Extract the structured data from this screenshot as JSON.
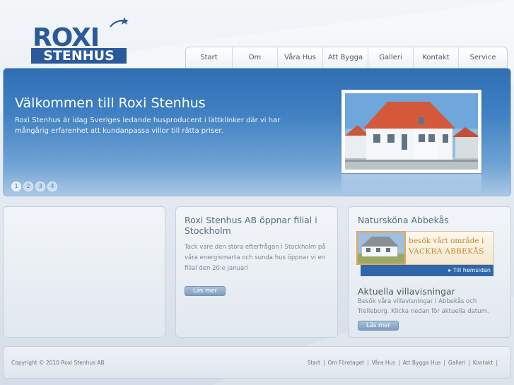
{
  "logo": {
    "line1": "ROXI",
    "line2": "STENHUS"
  },
  "nav": {
    "items": [
      {
        "label": "Start"
      },
      {
        "label": "Om"
      },
      {
        "label": "Våra Hus"
      },
      {
        "label": "Att Bygga"
      },
      {
        "label": "Galleri"
      },
      {
        "label": "Kontakt"
      },
      {
        "label": "Service"
      }
    ]
  },
  "hero": {
    "title": "Välkommen till Roxi Stenhus",
    "text": "Roxi Stenhus är idag Sveriges ledande husproducent i lättklinker där vi har mångårig erfarenhet att kundanpassa villor till rätta priser.",
    "dots": [
      "1",
      "2",
      "3",
      "4"
    ],
    "active_dot": 1
  },
  "news": {
    "title": "Roxi Stenhus AB öppnar filial i Stockholm",
    "body": "Tack vare den stora efterfrågan i Stockholm på våra energismarta och sunda hus öppnar vi en filial den 20:e januari",
    "button": "Läs mer"
  },
  "side": {
    "title": "Natursköna Abbekås",
    "banner_line1": "besök vårt område i",
    "banner_line2": "VACKRA ABBEKÅS",
    "banner_link": "▸ Till hemsidan",
    "title2": "Aktuella villavisningar",
    "body2": "Besök våra villavisningar i Abbekås och Trelleborg. Klicka nedan för aktuella datum.",
    "button": "Läs mer"
  },
  "footer": {
    "copyright": "Copyright ©  2010 Roxi Stenhus AB",
    "links": [
      {
        "label": "Start"
      },
      {
        "label": "Om Företaget"
      },
      {
        "label": "Våra Hus"
      },
      {
        "label": "Att Bygga Hus"
      },
      {
        "label": "Galleri"
      },
      {
        "label": "Kontakt"
      }
    ]
  },
  "colors": {
    "brand": "#2a5a9c",
    "hero_top": "#2f6eb3",
    "banner_text": "#c8892a",
    "button": "#8aa7c7"
  }
}
